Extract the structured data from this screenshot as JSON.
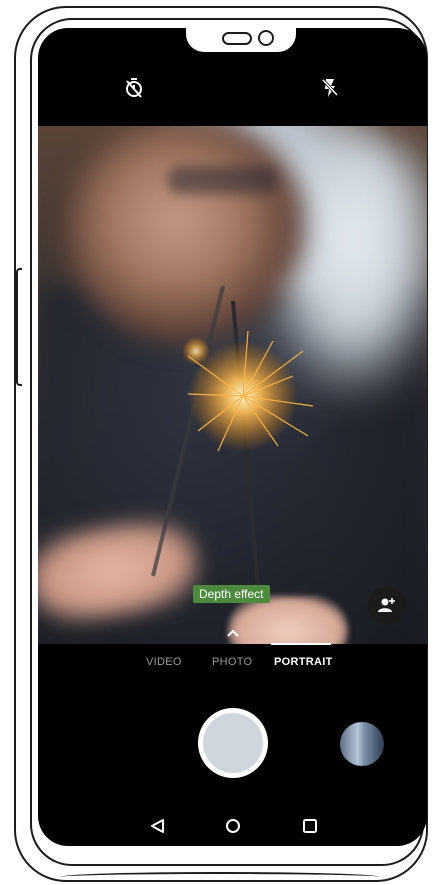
{
  "top_bar": {
    "timer_icon": "timer-off-icon",
    "flash_icon": "flash-off-icon"
  },
  "viewfinder": {
    "depth_effect_label": "Depth effect",
    "expand_icon": "chevron-up-icon",
    "portrait_person_icon": "person-add-icon"
  },
  "modes": {
    "items": [
      {
        "label": "VIDEO",
        "active": false
      },
      {
        "label": "PHOTO",
        "active": false
      },
      {
        "label": "PORTRAIT",
        "active": true
      }
    ]
  },
  "controls": {
    "shutter_icon": "shutter-button",
    "gallery_icon": "gallery-thumbnail"
  },
  "nav_bar": {
    "back_icon": "back-triangle-icon",
    "home_icon": "home-circle-icon",
    "recent_icon": "recent-square-icon"
  },
  "colors": {
    "screen_bg": "#000000",
    "depth_label_bg": "#4d8a3e",
    "active_mode": "#ffffff",
    "inactive_mode": "#9a9a9a"
  }
}
